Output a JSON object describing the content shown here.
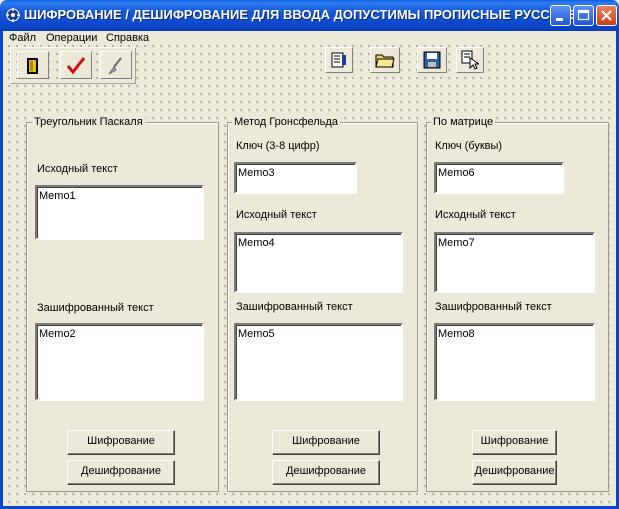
{
  "window": {
    "title": "ШИФРОВАНИЕ / ДЕШИФРОВАНИЕ     ДЛЯ ВВОДА ДОПУСТИМЫ ПРОПИСНЫЕ РУССКИЕ ...",
    "icon": "app-icon",
    "controls": [
      "minimize-icon",
      "maximize-icon",
      "close-icon"
    ]
  },
  "menu": [
    "Файл",
    "Операции",
    "Справка"
  ],
  "toolbar_left": [
    "exit-door-icon",
    "checkmark-icon",
    "brush-icon"
  ],
  "toolbar_right": [
    "properties-icon",
    "open-folder-icon",
    "save-disk-icon",
    "pointer-icon"
  ],
  "colors": {
    "titlebar": "#0a46c8",
    "face": "#ece9d8",
    "close": "#c5401a"
  },
  "panels": {
    "pascal": {
      "title": "Треугольник Паскаля",
      "source_label": "Исходный текст",
      "source_memo": "Memo1",
      "encrypted_label": "Зашифрованный текст",
      "encrypted_memo": "Memo2",
      "encrypt_button": "Шифрование",
      "decrypt_button": "Дешифрование"
    },
    "gronsfeld": {
      "title": "Метод Гронсфельда",
      "key_label": "Ключ (3-8 цифр)",
      "key_memo": "Memo3",
      "source_label": "Исходный текст",
      "source_memo": "Memo4",
      "encrypted_label": "Зашифрованный текст",
      "encrypted_memo": "Memo5",
      "encrypt_button": "Шифрование",
      "decrypt_button": "Дешифрование"
    },
    "matrix": {
      "title": "По матрице",
      "key_label": "Ключ (буквы)",
      "key_memo": "Memo6",
      "source_label": "Исходный текст",
      "source_memo": "Memo7",
      "encrypted_label": "Зашифрованный текст",
      "encrypted_memo": "Memo8",
      "encrypt_button": "Шифрование",
      "decrypt_button": "Дешифрование"
    }
  }
}
